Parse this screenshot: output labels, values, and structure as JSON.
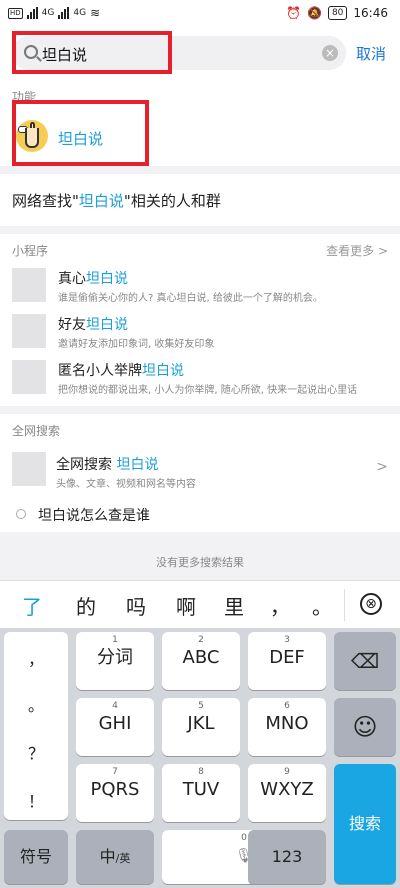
{
  "status_bar": {
    "time": "16:46",
    "battery": "80",
    "net_speed_1": "4G",
    "net_speed_2": "4G",
    "hd": "HD"
  },
  "search": {
    "query": "坦白说",
    "cancel_label": "取消"
  },
  "function_section": {
    "title": "功能",
    "item_name": "坦白说"
  },
  "network_search": {
    "prefix": "网络查找\"",
    "keyword": "坦白说",
    "suffix": "\"相关的人和群"
  },
  "mini_programs": {
    "title": "小程序",
    "more_label": "查看更多 >",
    "items": [
      {
        "name_prefix": "真心",
        "name_keyword": "坦白说",
        "desc": "谁是偷偷关心你的人? 真心坦白说, 给彼此一个了解的机会。"
      },
      {
        "name_prefix": "好友",
        "name_keyword": "坦白说",
        "desc": "邀请好友添加印象词, 收集好友印象"
      },
      {
        "name_prefix": "匿名小人举牌",
        "name_keyword": "坦白说",
        "desc": "把你想说的都说出来, 小人为你举牌, 随心所欲, 快来一起说出心里话"
      }
    ]
  },
  "web_search": {
    "title": "全网搜索",
    "name_prefix": "全网搜索 ",
    "name_keyword": "坦白说",
    "desc": "头像、文章、视频和网名等内容",
    "arrow": ">",
    "suggestion": "坦白说怎么查是谁"
  },
  "no_more": "没有更多搜索结果",
  "keyboard": {
    "candidates": [
      "了",
      "的",
      "吗",
      "啊",
      "里",
      "，",
      "。"
    ],
    "close_symbol": "⊗",
    "side_keys": [
      "，",
      "。",
      "？",
      "！"
    ],
    "keys": [
      {
        "num": "1",
        "label": "分词"
      },
      {
        "num": "2",
        "label": "ABC"
      },
      {
        "num": "3",
        "label": "DEF"
      },
      {
        "num": "4",
        "label": "GHI"
      },
      {
        "num": "5",
        "label": "JKL"
      },
      {
        "num": "6",
        "label": "MNO"
      },
      {
        "num": "7",
        "label": "PQRS"
      },
      {
        "num": "8",
        "label": "TUV"
      },
      {
        "num": "9",
        "label": "WXYZ"
      }
    ],
    "symbol_label": "符号",
    "lang_label": "中",
    "lang_sub": "/英",
    "space_num": "0",
    "num_label": "123",
    "search_label": "搜索",
    "backspace_symbol": "⌫",
    "emoji_symbol": "☺"
  }
}
